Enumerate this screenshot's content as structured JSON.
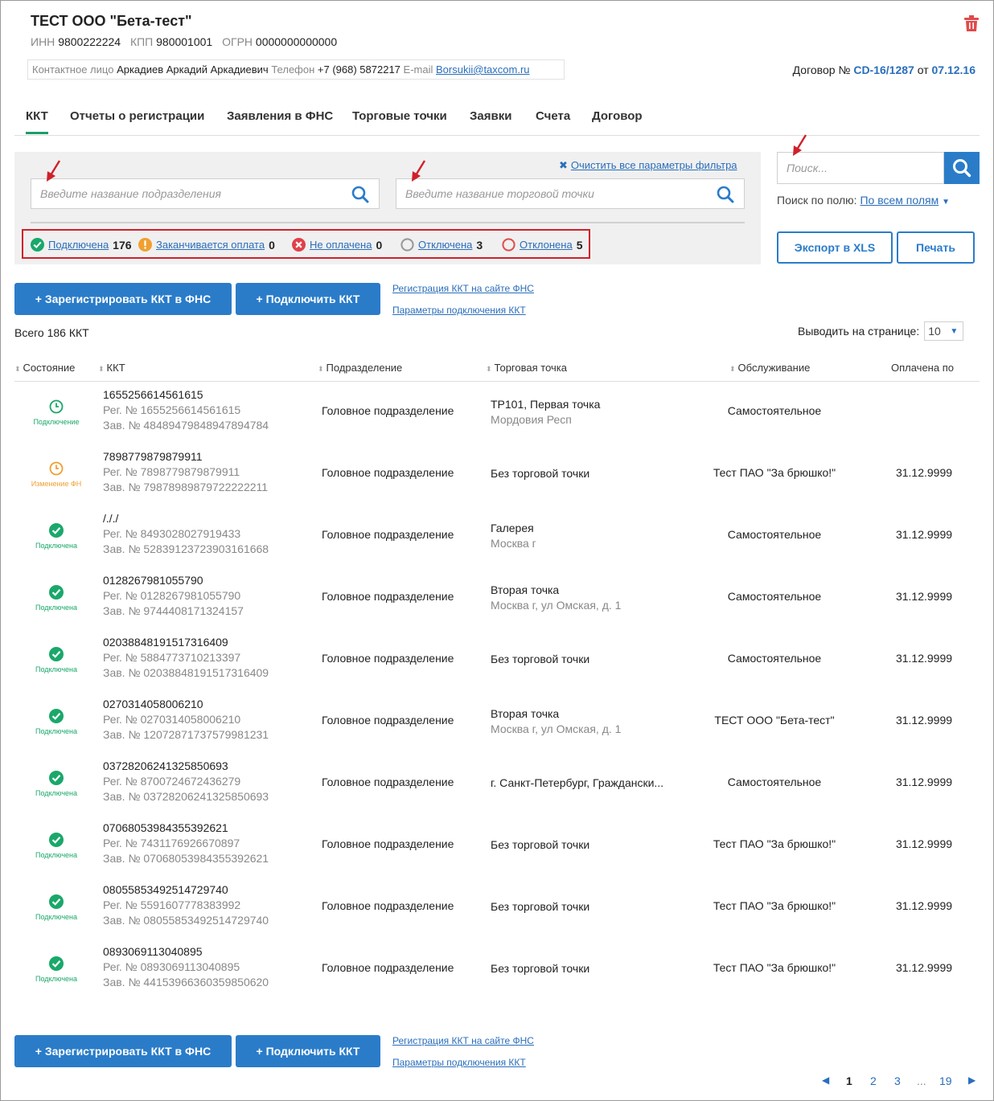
{
  "company": {
    "title": "ТЕСТ ООО \"Бета-тест\"",
    "inn_label": "ИНН",
    "inn": "9800222224",
    "kpp_label": "КПП",
    "kpp": "980001001",
    "ogrn_label": "ОГРН",
    "ogrn": "0000000000000",
    "contact_label": "Контактное лицо",
    "contact": "Аркадиев Аркадий Аркадиевич",
    "phone_label": "Телефон",
    "phone": "+7 (968) 5872217",
    "email_label": "E-mail",
    "email": "Borsukii@taxcom.ru",
    "contract_label": "Договор №",
    "contract_no": "CD-16/1287",
    "contract_from": "от",
    "contract_date": "07.12.16"
  },
  "tabs": [
    "ККТ",
    "Отчеты о регистрации",
    "Заявления в ФНС",
    "Торговые точки",
    "Заявки",
    "Счета",
    "Договор"
  ],
  "filters": {
    "clear_label": "Очистить все параметры фильтра",
    "division_placeholder": "Введите название подразделения",
    "point_placeholder": "Введите название торговой точки",
    "statuses": [
      {
        "label": "Подключена",
        "count": "176"
      },
      {
        "label": "Заканчивается оплата",
        "count": "0"
      },
      {
        "label": "Не оплачена",
        "count": "0"
      },
      {
        "label": "Отключена",
        "count": "3"
      },
      {
        "label": "Отклонена",
        "count": "5"
      }
    ]
  },
  "search": {
    "placeholder": "Поиск...",
    "field_label": "Поиск по полю:",
    "field_value": "По всем полям",
    "export_label": "Экспорт в XLS",
    "print_label": "Печать"
  },
  "actions": {
    "register_label": "+ Зарегистрировать ККТ в ФНС",
    "connect_label": "+ Подключить ККТ",
    "link_register": "Регистрация ККТ на сайте ФНС",
    "link_params": "Параметры подключения ККТ"
  },
  "list": {
    "total": "Всего 186 ККТ",
    "perpage_label": "Выводить на странице:",
    "perpage_value": "10",
    "columns": [
      "Состояние",
      "ККТ",
      "Подразделение",
      "Торговая точка",
      "Обслуживание",
      "Оплачена по"
    ],
    "reg_label": "Рег. №",
    "zav_label": "Зав. №",
    "rows": [
      {
        "state": "Подключение",
        "kind": "pending",
        "name": "1655256614561615",
        "reg": "1655256614561615",
        "zav": "48489479848947894784",
        "division": "Головное подразделение",
        "point": "ТР101, Первая точка",
        "point_sub": "Мордовия Респ",
        "service": "Самостоятельное",
        "paid": ""
      },
      {
        "state": "Изменение ФН",
        "kind": "change",
        "name": "7898779879879911",
        "reg": "7898779879879911",
        "zav": "79878989879722222211",
        "division": "Головное подразделение",
        "point": "Без торговой точки",
        "point_sub": "",
        "service": "Тест ПАО \"За брюшко!\"",
        "paid": "31.12.9999"
      },
      {
        "state": "Подключена",
        "kind": "ok",
        "name": "/././",
        "reg": "8493028027919433",
        "zav": "52839123723903161668",
        "division": "Головное подразделение",
        "point": "Галерея",
        "point_sub": "Москва г",
        "service": "Самостоятельное",
        "paid": "31.12.9999"
      },
      {
        "state": "Подключена",
        "kind": "ok",
        "name": "0128267981055790",
        "reg": "0128267981055790",
        "zav": "9744408171324157",
        "division": "Головное подразделение",
        "point": "Вторая точка",
        "point_sub": "Москва г, ул Омская, д. 1",
        "service": "Самостоятельное",
        "paid": "31.12.9999"
      },
      {
        "state": "Подключена",
        "kind": "ok",
        "name": "02038848191517316409",
        "reg": "5884773710213397",
        "zav": "02038848191517316409",
        "division": "Головное подразделение",
        "point": "Без торговой точки",
        "point_sub": "",
        "service": "Самостоятельное",
        "paid": "31.12.9999"
      },
      {
        "state": "Подключена",
        "kind": "ok",
        "name": "0270314058006210",
        "reg": "0270314058006210",
        "zav": "12072871737579981231",
        "division": "Головное подразделение",
        "point": "Вторая точка",
        "point_sub": "Москва г, ул Омская, д. 1",
        "service": "ТЕСТ ООО \"Бета-тест\"",
        "paid": "31.12.9999"
      },
      {
        "state": "Подключена",
        "kind": "ok",
        "name": "03728206241325850693",
        "reg": "8700724672436279",
        "zav": "03728206241325850693",
        "division": "Головное подразделение",
        "point": "г. Санкт-Петербург, Граждански...",
        "point_sub": "",
        "service": "Самостоятельное",
        "paid": "31.12.9999"
      },
      {
        "state": "Подключена",
        "kind": "ok",
        "name": "07068053984355392621",
        "reg": "7431176926670897",
        "zav": "07068053984355392621",
        "division": "Головное подразделение",
        "point": "Без торговой точки",
        "point_sub": "",
        "service": "Тест ПАО \"За брюшко!\"",
        "paid": "31.12.9999"
      },
      {
        "state": "Подключена",
        "kind": "ok",
        "name": "08055853492514729740",
        "reg": "5591607778383992",
        "zav": "08055853492514729740",
        "division": "Головное подразделение",
        "point": "Без торговой точки",
        "point_sub": "",
        "service": "Тест ПАО \"За брюшко!\"",
        "paid": "31.12.9999"
      },
      {
        "state": "Подключена",
        "kind": "ok",
        "name": "0893069113040895",
        "reg": "0893069113040895",
        "zav": "44153966360359850620",
        "division": "Головное подразделение",
        "point": "Без торговой точки",
        "point_sub": "",
        "service": "Тест ПАО \"За брюшко!\"",
        "paid": "31.12.9999"
      }
    ]
  },
  "pagination": {
    "pages": [
      "1",
      "2",
      "3",
      "...",
      "19"
    ],
    "current": "1"
  },
  "colors": {
    "accent": "#2a7cc9",
    "ok": "#1aa86a",
    "warn": "#f0a030",
    "error": "#e0404a",
    "off": "#999999",
    "rejected": "#e05050"
  }
}
